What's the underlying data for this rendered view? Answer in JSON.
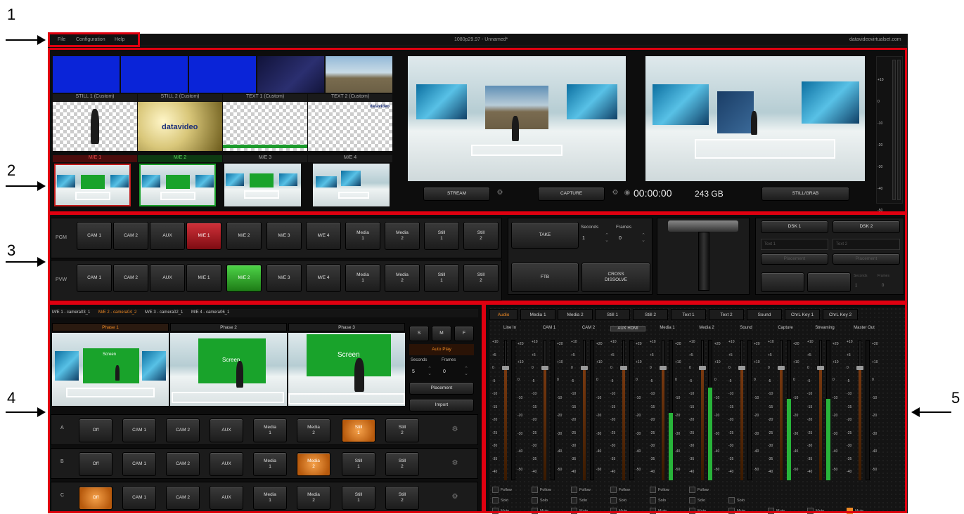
{
  "annotations": {
    "n1": "1",
    "n2": "2",
    "n3": "3",
    "n4": "4",
    "n5": "5"
  },
  "menu": {
    "file": "File",
    "configuration": "Configuration",
    "help": "Help",
    "title": "1080p29.97 - Unnamed*",
    "site": "datavideovirtualset.com"
  },
  "sources": {
    "row2_labels": [
      "STILL 1 (Custom)",
      "STILL 2 (Custom)",
      "TEXT 1 (Custom)",
      "TEXT 2 (Custom)"
    ],
    "me_labels": [
      "M/E 1",
      "M/E 2",
      "M/E 3",
      "M/E 4"
    ],
    "logo": "datavideo"
  },
  "output": {
    "stream": "STREAM",
    "capture": "CAPTURE",
    "timer": "00:00:00",
    "storage": "243 GB",
    "still_grab": "STILL/GRAB",
    "meter_scale": [
      "+10",
      "0",
      "-10",
      "-20",
      "-30",
      "-40",
      "-50"
    ]
  },
  "switcher": {
    "pgm_label": "PGM",
    "pvw_label": "PVW",
    "pgm": [
      "CAM 1",
      "CAM 2",
      "AUX",
      "M/E 1",
      "M/E 2",
      "M/E 3",
      "M/E 4",
      "Media\n1",
      "Media\n2",
      "Still\n1",
      "Still\n2"
    ],
    "pvw": [
      "CAM 1",
      "CAM 2",
      "AUX",
      "M/E 1",
      "M/E 2",
      "M/E 3",
      "M/E 4",
      "Media\n1",
      "Media\n2",
      "Still\n1",
      "Still\n2"
    ],
    "take": "TAKE",
    "ftb": "FTB",
    "cross": "CROSS\nDISSOLVE",
    "seconds": "Seconds",
    "frames": "Frames",
    "sec_val": "1",
    "frm_val": "0",
    "dsk1": "DSK 1",
    "dsk2": "DSK 2",
    "text1": "Text 1",
    "text2": "Text 2",
    "placement": "Placement",
    "dsk_seconds": "Seconds",
    "dsk_frames": "Frames",
    "dsk_sec_val": "1",
    "dsk_frm_val": "0"
  },
  "me_panel": {
    "tabs": [
      "M/E 1 - camera03_1",
      "M/E 2 - camera04_2",
      "M/E 3 - camera02_1",
      "M/E 4 - camera06_1"
    ],
    "phases": [
      "Phase 1",
      "Phase 2",
      "Phase 3"
    ],
    "smf": [
      "S",
      "M",
      "F"
    ],
    "auto_play": "Auto Play",
    "seconds": "Seconds",
    "frames": "Frames",
    "sec_val": "5",
    "frm_val": "0",
    "placement": "Placement",
    "import": "Import",
    "screen": "Screen",
    "rows": [
      {
        "label": "A",
        "buttons": [
          "Off",
          "CAM 1",
          "CAM 2",
          "AUX",
          "Media\n1",
          "Media\n2",
          "Still\n1",
          "Still\n2"
        ]
      },
      {
        "label": "B",
        "buttons": [
          "Off",
          "CAM 1",
          "CAM 2",
          "AUX",
          "Media\n1",
          "Media\n2",
          "Still\n1",
          "Still\n2"
        ]
      },
      {
        "label": "C",
        "buttons": [
          "Off",
          "CAM 1",
          "CAM 2",
          "AUX",
          "Media\n1",
          "Media\n2",
          "Still\n1",
          "Still\n2"
        ]
      }
    ]
  },
  "audio": {
    "tabs": [
      "Audio",
      "Media 1",
      "Media 2",
      "Still 1",
      "Still 2",
      "Text 1",
      "Text 2",
      "Sound",
      "ChrL Key 1",
      "ChrL Key 2"
    ],
    "channels": [
      "Line In",
      "CAM 1",
      "CAM 2",
      "AUX HDMI",
      "Media 1",
      "Media 2",
      "Sound",
      "Capture",
      "Streaming",
      "Master Out"
    ],
    "scale_left": [
      "+10",
      "+5",
      "0",
      "-5",
      "-10",
      "-15",
      "-20",
      "-25",
      "-30",
      "-35",
      "-40"
    ],
    "scale_right": [
      "+20",
      "+10",
      "0",
      "-10",
      "-20",
      "-30",
      "-40",
      "-50"
    ],
    "follow": "Follow",
    "solo": "Solo",
    "mute": "Mute"
  }
}
